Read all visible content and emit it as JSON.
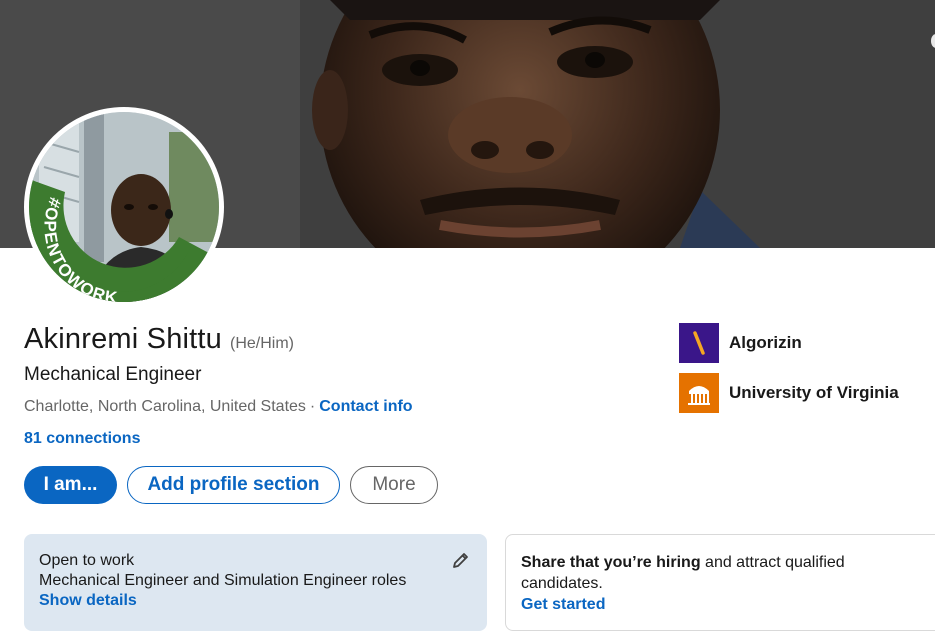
{
  "profile": {
    "name": "Akinremi Shittu",
    "pronouns": "(He/Him)",
    "headline": "Mechanical Engineer",
    "location": "Charlotte, North Carolina, United States",
    "separator": "·",
    "contact_info": "Contact info",
    "connections": "81 connections",
    "avatar_frame_text": "#OPENTOWORK"
  },
  "actions": {
    "primary": "I am...",
    "add_section": "Add profile section",
    "more": "More"
  },
  "organizations": [
    {
      "name": "Algorizin",
      "logo_icon": "algorizin-logo",
      "color": "#3a1689"
    },
    {
      "name": "University of Virginia",
      "logo_icon": "uva-rotunda-logo",
      "color": "#e57200"
    }
  ],
  "open_to_work": {
    "title": "Open to work",
    "roles": "Mechanical Engineer and Simulation Engineer roles",
    "details_link": "Show details",
    "edit_icon": "pencil-icon"
  },
  "hiring": {
    "bold_text": "Share that you’re hiring",
    "rest_text": " and attract qualified candidates.",
    "cta": "Get started"
  },
  "colors": {
    "accent": "#0a66c2",
    "open_to_work_green": "#3a7a2c",
    "card_bg": "#dde7f1"
  }
}
